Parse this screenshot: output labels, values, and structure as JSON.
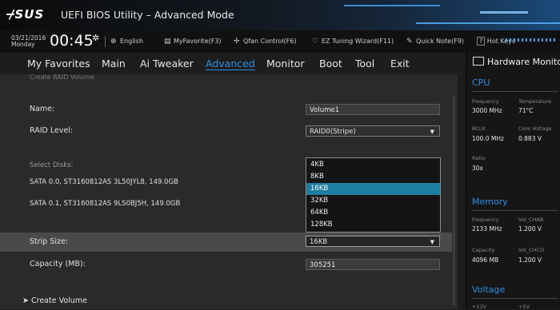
{
  "title": {
    "logo": "/SUS",
    "app_title": "UEFI BIOS Utility – Advanced Mode"
  },
  "infobar": {
    "date": "03/21/2016",
    "day": "Monday",
    "time": "00:45",
    "time_icon": "gear-icon",
    "language": "English",
    "myfavorite": "MyFavorite(F3)",
    "qfan": "Qfan Control(F6)",
    "ez_tuning": "EZ Tuning Wizard(F11)",
    "quick_note": "Quick Note(F9)",
    "hot_keys": "Hot Keys"
  },
  "nav": {
    "tabs": [
      {
        "label": "My Favorites"
      },
      {
        "label": "Main"
      },
      {
        "label": "Ai Tweaker"
      },
      {
        "label": "Advanced",
        "active": true
      },
      {
        "label": "Monitor"
      },
      {
        "label": "Boot"
      },
      {
        "label": "Tool"
      },
      {
        "label": "Exit"
      }
    ]
  },
  "main": {
    "section_title": "Create RAID Volume",
    "name_label": "Name:",
    "name_value": "Volume1",
    "raid_label": "RAID Level:",
    "raid_value": "RAID0(Stripe)",
    "select_disks_label": "Select Disks:",
    "disk0": "SATA 0.0, ST3160812AS 3L50JYL8, 149.0GB",
    "disk1": "SATA 0.1, ST3160812AS 9LS0BJ5H, 149.0GB",
    "strip_label": "Strip Size:",
    "strip_value": "16KB",
    "strip_options": [
      "4KB",
      "8KB",
      "16KB",
      "32KB",
      "64KB",
      "128KB"
    ],
    "strip_selected": "16KB",
    "capacity_label": "Capacity (MB):",
    "capacity_value": "305251",
    "create_volume": "Create Volume",
    "accent_color": "#1d7fa0"
  },
  "hw_monitor": {
    "title": "Hardware Monitor",
    "cpu": {
      "heading": "CPU",
      "frequency_label": "Frequency",
      "frequency": "3000 MHz",
      "temperature_label": "Temperature",
      "temperature": "71°C",
      "bclk_label": "BCLK",
      "bclk": "100.0 MHz",
      "core_voltage_label": "Core Voltage",
      "core_voltage": "0.883 V",
      "ratio_label": "Ratio",
      "ratio": "30x"
    },
    "memory": {
      "heading": "Memory",
      "frequency_label": "Frequency",
      "frequency": "2133 MHz",
      "vol_chab_label": "Vol_CHAB",
      "vol_chab": "1.200 V",
      "capacity_label": "Capacity",
      "capacity": "4096 MB",
      "vol_chcd_label": "Vol_CHCD",
      "vol_chcd": "1.200 V"
    },
    "voltage": {
      "heading": "Voltage",
      "v12_label": "+12V",
      "v5_label": "+5V"
    }
  }
}
